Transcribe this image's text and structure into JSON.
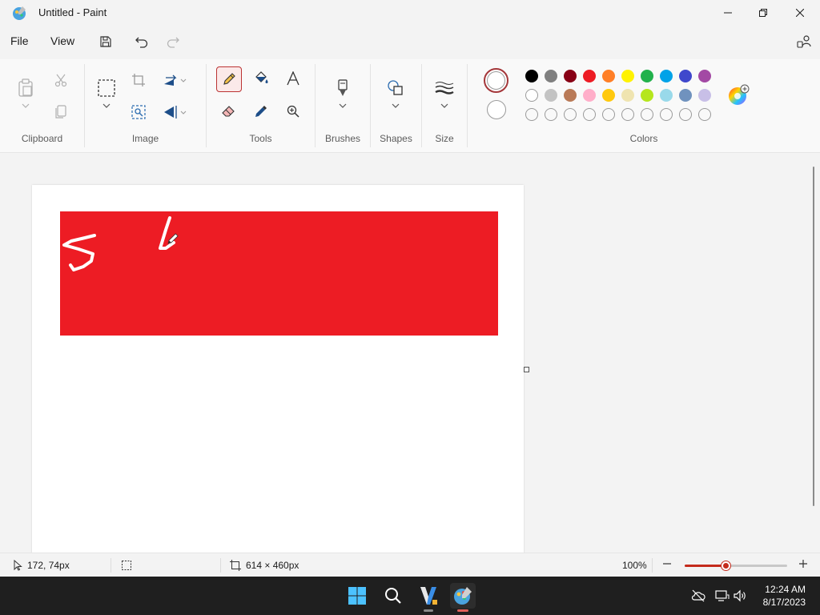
{
  "window": {
    "title": "Untitled - Paint"
  },
  "menu": {
    "file": "File",
    "view": "View"
  },
  "ribbon": {
    "groups": {
      "clipboard": "Clipboard",
      "image": "Image",
      "tools": "Tools",
      "brushes": "Brushes",
      "shapes": "Shapes",
      "size": "Size",
      "colors": "Colors"
    },
    "colors": {
      "primary": "#ffffff",
      "secondary": "#ffffff",
      "row1": [
        "#000000",
        "#7f7f7f",
        "#880015",
        "#ed1c24",
        "#ff7f27",
        "#fff200",
        "#22b14c",
        "#00a2e8",
        "#3f48cc",
        "#a349a4"
      ],
      "row2": [
        "#ffffff",
        "#c3c3c3",
        "#b97a57",
        "#ffaec9",
        "#ffc90e",
        "#efe4b0",
        "#b5e61d",
        "#99d9ea",
        "#7092be",
        "#c8bfe7"
      ],
      "row3": [
        "",
        "",
        "",
        "",
        "",
        "",
        "",
        "",
        "",
        ""
      ]
    }
  },
  "canvas": {
    "rect_color": "#ed1c24"
  },
  "status": {
    "cursor_position": "172, 74px",
    "canvas_size": "614 × 460px",
    "zoom": "100%",
    "zoom_level_fraction": 0.4
  },
  "taskbar": {
    "time": "12:24 AM",
    "date": "8/17/2023"
  }
}
